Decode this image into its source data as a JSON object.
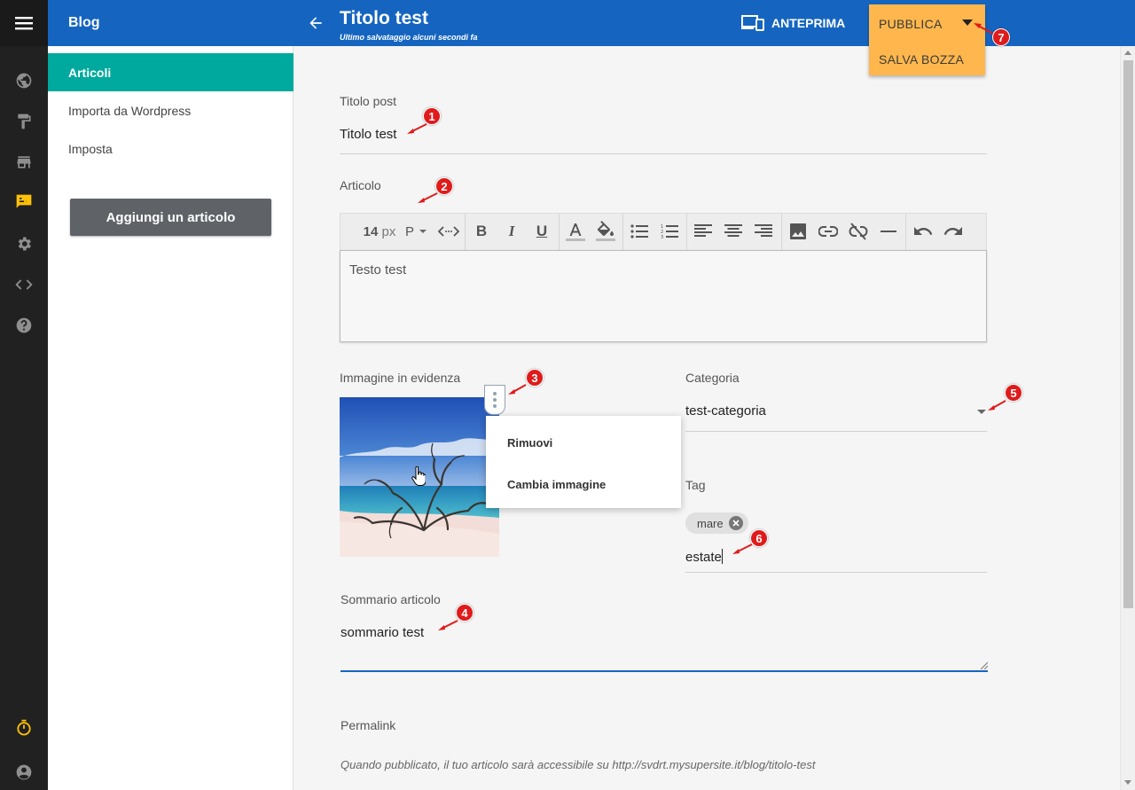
{
  "sidebar": {
    "title": "Blog",
    "items": [
      {
        "label": "Articoli",
        "active": true
      },
      {
        "label": "Importa da Wordpress"
      },
      {
        "label": "Imposta"
      }
    ],
    "add_button": "Aggiungi un articolo"
  },
  "rail": {
    "icons": [
      "menu-icon",
      "globe-icon",
      "paint-roller-icon",
      "store-icon",
      "blog-edit-icon",
      "gear-icon",
      "code-icon",
      "help-icon",
      "timer-icon",
      "account-icon"
    ],
    "active_color": "#ffc107"
  },
  "header": {
    "title": "Titolo test",
    "subtitle": "Ultimo salvataggio alcuni secondi fa",
    "preview_label": "ANTEPRIMA",
    "publish_label": "PUBBLICA",
    "save_draft_label": "SALVA BOZZA"
  },
  "form": {
    "title_label": "Titolo post",
    "title_value": "Titolo test",
    "article_label": "Articolo",
    "font_size": "14",
    "font_unit": "px",
    "paragraph": "P",
    "editor_text": "Testo test",
    "image_label": "Immagine in evidenza",
    "image_menu": [
      "Rimuovi",
      "Cambia immagine"
    ],
    "category_label": "Categoria",
    "category_value": "test-categoria",
    "tag_label": "Tag",
    "tags": [
      "mare"
    ],
    "tag_input": "estate",
    "summary_label": "Sommario articolo",
    "summary_value": "sommario test",
    "permalink_label": "Permalink",
    "permalink_text": "Quando pubblicato, il tuo articolo sarà accessibile su http://svdrt.mysupersite.it/blog/titolo-test"
  },
  "annotations": [
    "1",
    "2",
    "3",
    "4",
    "5",
    "6",
    "7"
  ],
  "colors": {
    "header": "#1565c0",
    "active_item": "#00a99d",
    "publish": "#ffb74d",
    "annotation": "#e01b1b"
  }
}
